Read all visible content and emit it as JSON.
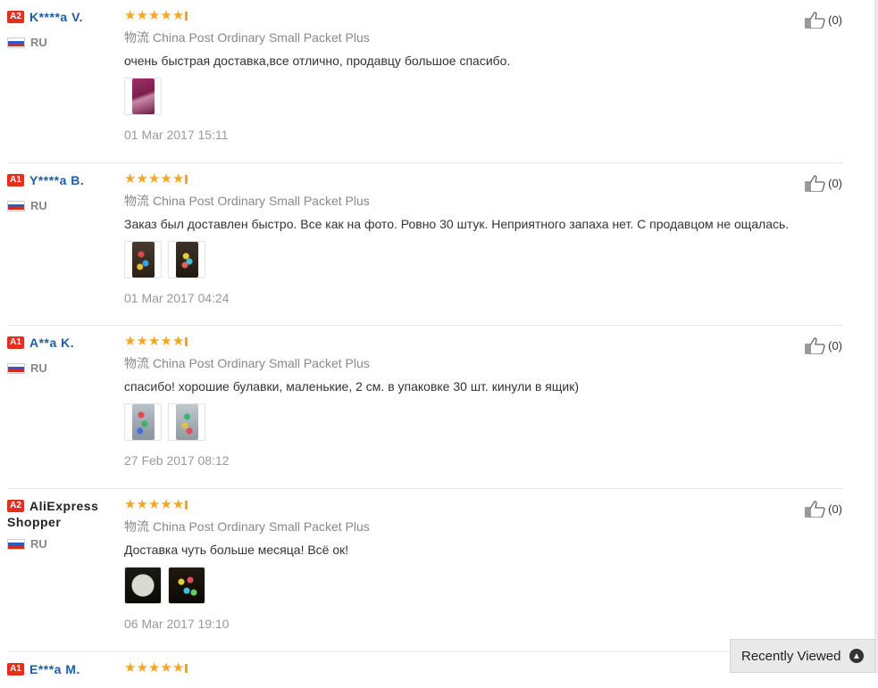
{
  "reviews": [
    {
      "level": "A2",
      "user": "K****a V.",
      "country": "RU",
      "rating": 5,
      "shipping_cn": "物流",
      "shipping": "China Post Ordinary Small Packet Plus",
      "text": "очень быстрая доставка,все отлично, продавцу большое спасибо.",
      "photos": [
        "review-photo"
      ],
      "date": "01 Mar 2017 15:11",
      "helpful": "(0)"
    },
    {
      "level": "A1",
      "user": "Y****a B.",
      "country": "RU",
      "rating": 5,
      "shipping_cn": "物流",
      "shipping": "China Post Ordinary Small Packet Plus",
      "text": "Заказ был доставлен быстро. Все как на фото. Ровно 30 штук. Неприятного запаха нет. С продавцом не ощалась.",
      "photos": [
        "review-photo",
        "review-photo"
      ],
      "date": "01 Mar 2017 04:24",
      "helpful": "(0)"
    },
    {
      "level": "A1",
      "user": "A**a K.",
      "country": "RU",
      "rating": 5,
      "shipping_cn": "物流",
      "shipping": "China Post Ordinary Small Packet Plus",
      "text": "спасибо! хорошие булавки, маленькие, 2 см. в упаковке 30 шт. кинули в ящик)",
      "photos": [
        "review-photo",
        "review-photo"
      ],
      "date": "27 Feb 2017 08:12",
      "helpful": "(0)"
    },
    {
      "level": "A2",
      "user": "AliExpress Shopper",
      "country": "RU",
      "rating": 5,
      "shipping_cn": "物流",
      "shipping": "China Post Ordinary Small Packet Plus",
      "text": "Доставка чуть больше месяца! Всё ок!",
      "photos": [
        "review-photo",
        "review-photo"
      ],
      "date": "06 Mar 2017 19:10",
      "helpful": "(0)"
    },
    {
      "level": "A1",
      "user": "E***a M.",
      "rating": 5
    }
  ],
  "recently_viewed": {
    "label": "Recently Viewed",
    "icon": "chevron-up-icon"
  },
  "colors": {
    "badge": "#e0301e",
    "username": "#1a5fa6",
    "star": "#f5a623"
  }
}
